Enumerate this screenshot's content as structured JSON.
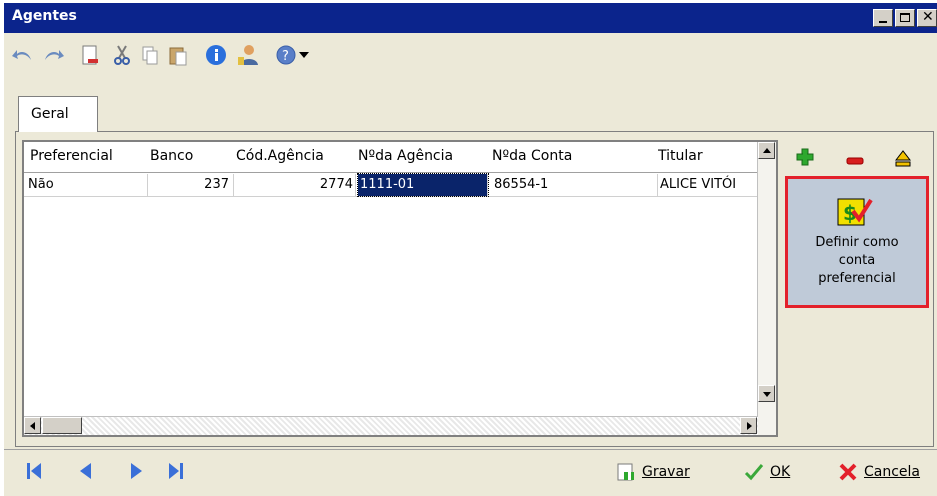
{
  "window": {
    "title": "Agentes"
  },
  "toolbar": {
    "icons": [
      "undo-icon",
      "redo-icon",
      "new-document-icon",
      "cut-icon",
      "copy-icon",
      "paste-icon",
      "info-icon",
      "user-icon",
      "help-icon",
      "dropdown-arrow-icon"
    ]
  },
  "tabs": [
    {
      "label": "Geral"
    }
  ],
  "grid": {
    "columns": [
      "Preferencial",
      "Banco",
      "Cód.Agência",
      "Nºda Agência",
      "Nºda Conta",
      "Titular"
    ],
    "rows": [
      {
        "preferencial": "Não",
        "banco": "237",
        "cod_agencia": "2774",
        "n_agencia": "1111-01",
        "n_conta": "86554-1",
        "titular": "ALICE VITÓI"
      }
    ]
  },
  "side": {
    "add_icon": "plus-icon",
    "remove_icon": "minus-icon",
    "eject_icon": "eject-icon",
    "preferential_label_1": "Definir como",
    "preferential_label_2": "conta",
    "preferential_label_3": "preferencial"
  },
  "bottom": {
    "save_label": "Gravar",
    "ok_label": "OK",
    "cancel_label": "Cancela"
  },
  "colors": {
    "titlebar": "#0b248c",
    "highlight": "#e3202a",
    "selection": "#0a246a"
  }
}
